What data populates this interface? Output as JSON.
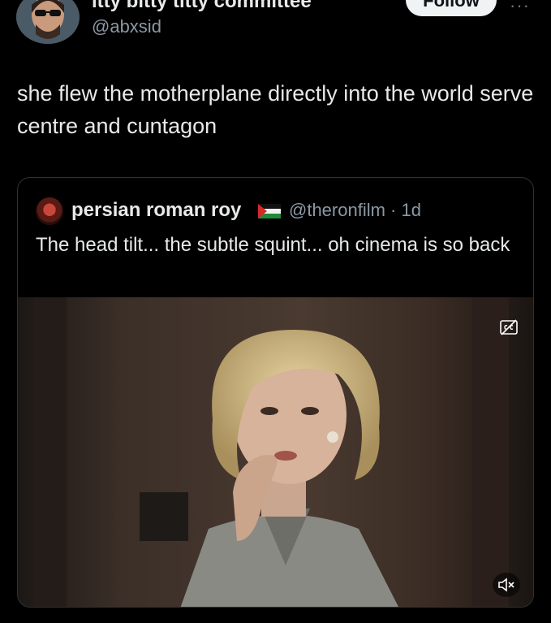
{
  "author": {
    "display_name": "itty bitty titty committee",
    "handle": "@abxsid",
    "follow_label": "Follow"
  },
  "tweet": {
    "text": "she flew the motherplane directly into the world serve centre and cuntagon"
  },
  "quoted": {
    "display_name": "persian roman roy",
    "flag_icon": "palestine-flag-icon",
    "handle_time": "@theronfilm · 1d",
    "text": "The head tilt... the subtle squint... oh cinema is so back"
  },
  "media": {
    "captions_icon": "closed-captions-icon",
    "mute_icon": "muted-speaker-icon"
  },
  "colors": {
    "background": "#000000",
    "text": "#e7e9ea",
    "secondary": "#8b98a5",
    "border": "#2f3336"
  }
}
